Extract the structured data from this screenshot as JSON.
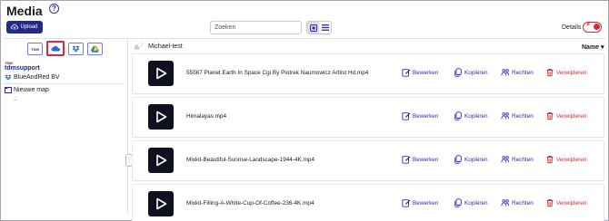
{
  "header": {
    "title": "Media",
    "help": "?",
    "upload_label": "Upload",
    "search_placeholder": "Zoeken",
    "details_label": "Details"
  },
  "providers": [
    {
      "name": "TDM",
      "label": "TDM"
    },
    {
      "name": "onedrive",
      "label": ""
    },
    {
      "name": "dropbox",
      "label": ""
    },
    {
      "name": "google-drive",
      "label": ""
    }
  ],
  "tree": {
    "account_name": "tdmsupport",
    "account_badge": "TDM",
    "company": "BlueAndRed BV",
    "folder": "Nieuwe map",
    "folder_child": ".."
  },
  "breadcrumb": {
    "current": "Michael-test"
  },
  "sort": {
    "label": "Name",
    "direction": "▾"
  },
  "actions": {
    "edit": "Bewerken",
    "copy": "Kopiëren",
    "rights": "Rechten",
    "delete": "Verwijderen"
  },
  "files": [
    {
      "name": "55567 Planet Earth In Space Cgi By Piotrek Naumowicz Artlist Hd.mp4"
    },
    {
      "name": "Himalayas.mp4"
    },
    {
      "name": "Mixkit-Beautiful-Sunrise-Landscape-1944-4K.mp4"
    },
    {
      "name": "Mixkit-Filling-A-White-Cup-Of-Coffee-236-4K.mp4"
    }
  ],
  "colors": {
    "brand": "#232a8c",
    "action": "#2b2bbf",
    "danger": "#d62a2a",
    "thumb": "#0f1020"
  }
}
